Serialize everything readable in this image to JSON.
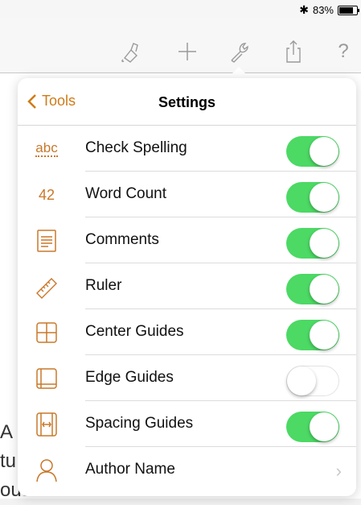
{
  "status_bar": {
    "bluetooth_icon": "bluetooth-icon",
    "battery_percent": "83%",
    "battery_level": 0.83
  },
  "toolbar": {
    "icons": [
      "paint-bucket-icon",
      "plus-icon",
      "wrench-icon",
      "share-icon",
      "help-icon"
    ],
    "help_label": "?"
  },
  "document": {
    "lines": [
      "A",
      "tu",
      "ous recevme"
    ]
  },
  "popover": {
    "back_label": "Tools",
    "title": "Settings",
    "rows": [
      {
        "icon": "abc-icon",
        "icon_text": "abc",
        "label": "Check Spelling",
        "type": "toggle",
        "on": true
      },
      {
        "icon": "word-count-icon",
        "icon_text": "42",
        "label": "Word Count",
        "type": "toggle",
        "on": true
      },
      {
        "icon": "comments-icon",
        "label": "Comments",
        "type": "toggle",
        "on": true
      },
      {
        "icon": "ruler-icon",
        "label": "Ruler",
        "type": "toggle",
        "on": true
      },
      {
        "icon": "center-guides-icon",
        "label": "Center Guides",
        "type": "toggle",
        "on": true
      },
      {
        "icon": "edge-guides-icon",
        "label": "Edge Guides",
        "type": "toggle",
        "on": false
      },
      {
        "icon": "spacing-guides-icon",
        "label": "Spacing Guides",
        "type": "toggle",
        "on": true
      },
      {
        "icon": "person-icon",
        "label": "Author Name",
        "type": "disclosure"
      }
    ]
  },
  "colors": {
    "accent": "#d07b17",
    "toggle_on": "#4cd964",
    "toggle_off_border": "#e3e3e3"
  }
}
